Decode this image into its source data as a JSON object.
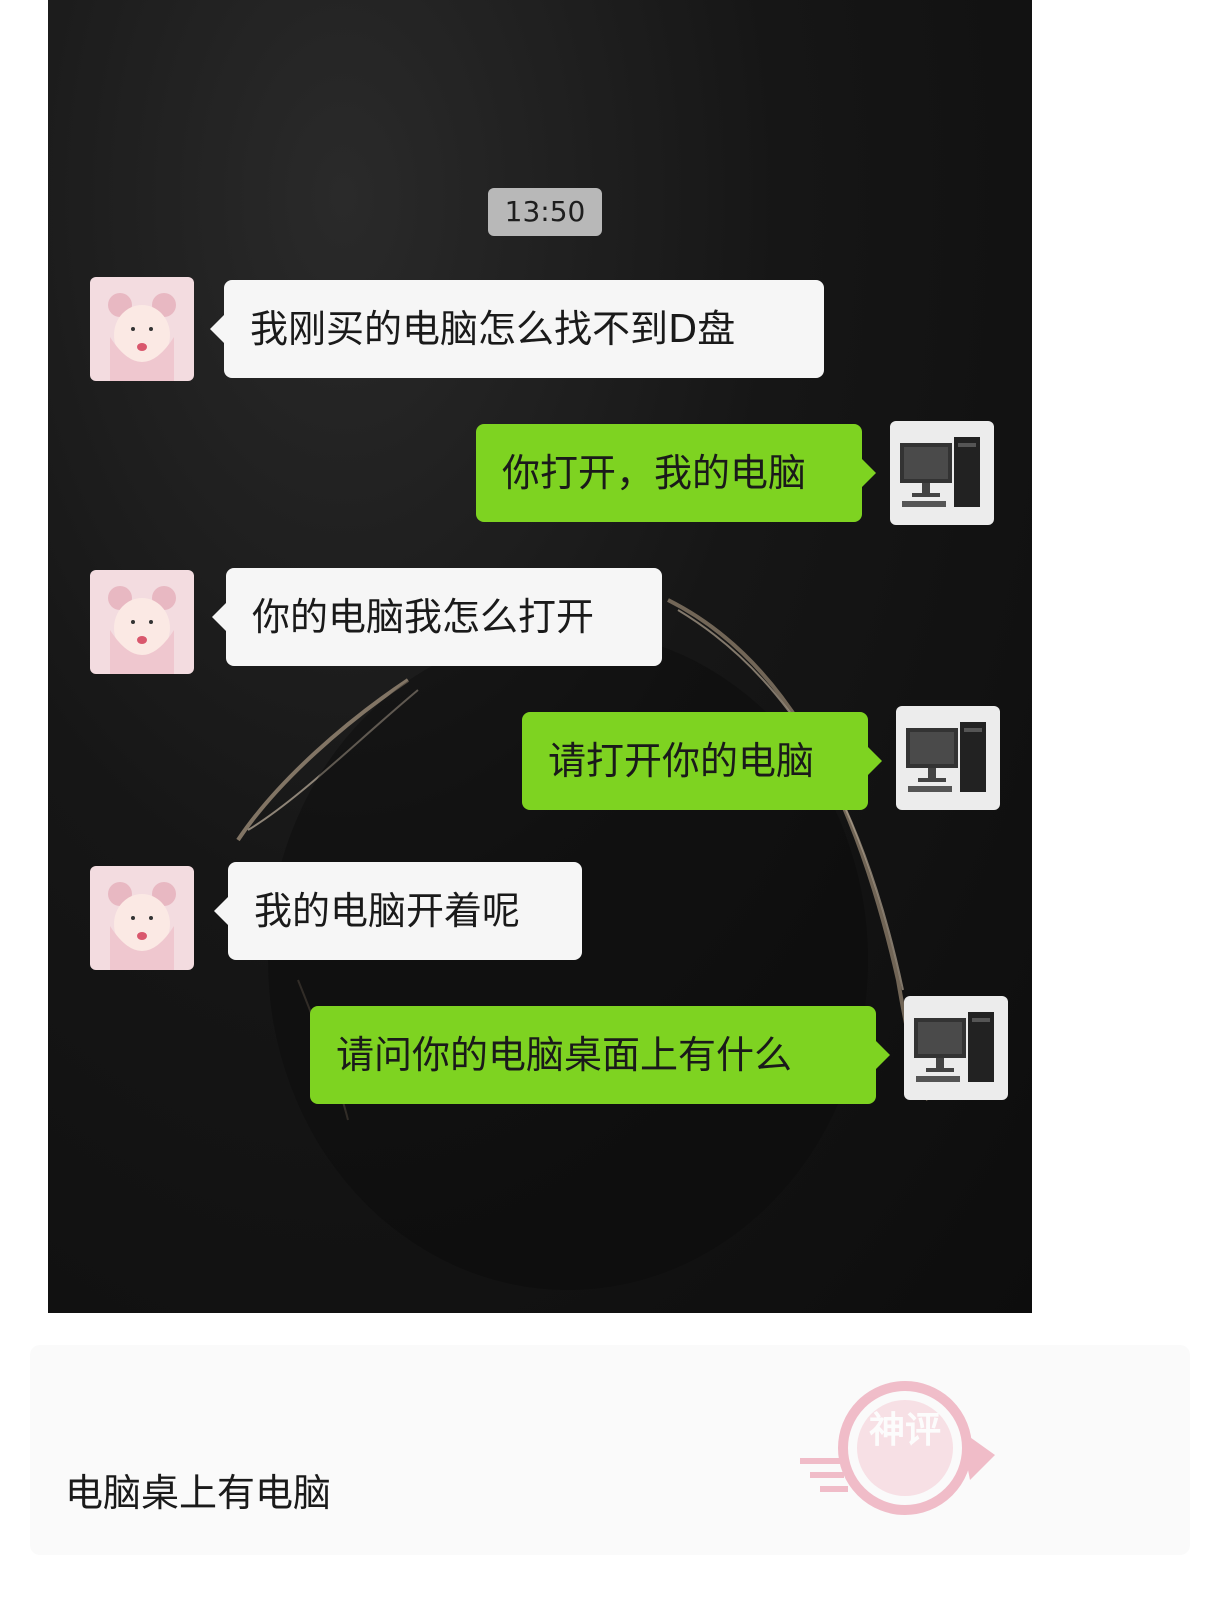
{
  "chat": {
    "timestamp": "13:50",
    "messages": [
      {
        "side": "left",
        "avatar": "girl-avatar",
        "text": "我刚买的电脑怎么找不到D盘"
      },
      {
        "side": "right",
        "avatar": "computer-avatar",
        "text": "你打开，我的电脑"
      },
      {
        "side": "left",
        "avatar": "girl-avatar",
        "text": "你的电脑我怎么打开"
      },
      {
        "side": "right",
        "avatar": "computer-avatar",
        "text": "请打开你的电脑"
      },
      {
        "side": "left",
        "avatar": "girl-avatar",
        "text": "我的电脑开着呢"
      },
      {
        "side": "right",
        "avatar": "computer-avatar",
        "text": "请问你的电脑桌面上有什么"
      }
    ]
  },
  "caption": "电脑桌上有电脑",
  "watermark": {
    "text": "神评",
    "color": "#e88aa0"
  },
  "colors": {
    "sent_bubble": "#7ed321",
    "received_bubble": "#f6f6f6",
    "timestamp_bg": "#b8b8b8"
  }
}
